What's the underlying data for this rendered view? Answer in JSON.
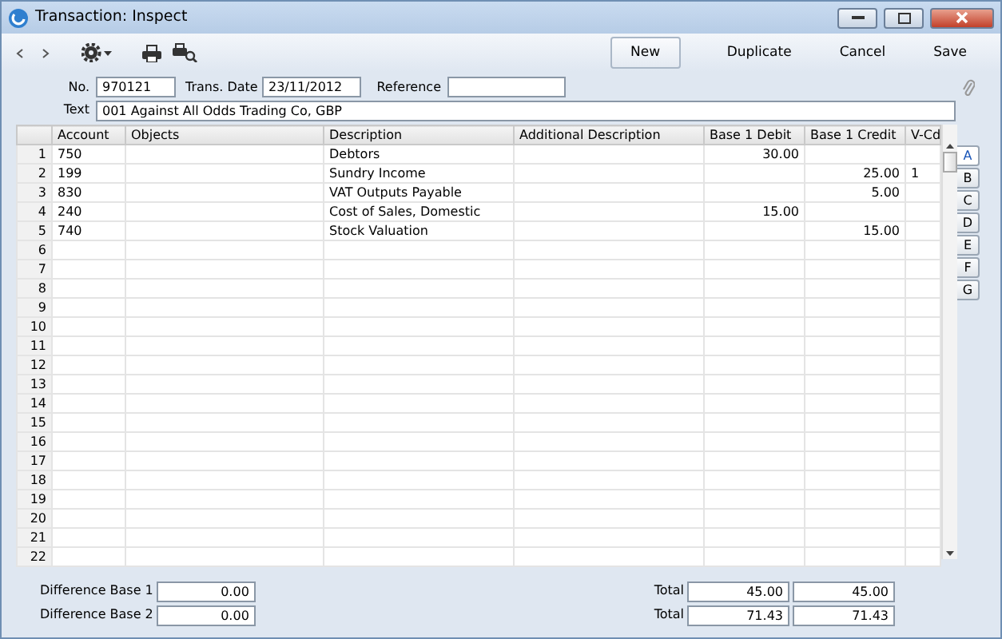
{
  "window": {
    "title": "Transaction: Inspect"
  },
  "toolbar": {
    "buttons": [
      {
        "label": "New",
        "default": true
      },
      {
        "label": "Duplicate",
        "default": false
      },
      {
        "label": "Cancel",
        "default": false
      },
      {
        "label": "Save",
        "default": false
      }
    ]
  },
  "header": {
    "fields": [
      {
        "label": "No.",
        "value": "970121"
      },
      {
        "label": "Trans. Date",
        "value": "23/11/2012"
      },
      {
        "label": "Reference"
      }
    ],
    "text": {
      "label": "Text",
      "value": "001 Against All Odds Trading Co, GBP"
    }
  },
  "table": {
    "columns": [
      "Account",
      "Objects",
      "Description",
      "Additional Description",
      "Base 1 Debit",
      "Base 1 Credit",
      "V-Cd"
    ],
    "rows": [
      {
        "number": "1",
        "account": "750",
        "description": "Debtors",
        "base_1_debit": "30.00"
      },
      {
        "number": "2",
        "account": "199",
        "description": "Sundry Income",
        "base_1_credit": "25.00",
        "v_cd": "1"
      },
      {
        "number": "3",
        "account": "830",
        "description": "VAT Outputs Payable",
        "base_1_credit": "5.00"
      },
      {
        "number": "4",
        "account": "240",
        "description": "Cost of Sales, Domestic",
        "base_1_debit": "15.00"
      },
      {
        "number": "5",
        "account": "740",
        "description": "Stock Valuation",
        "base_1_credit": "15.00"
      },
      {
        "number": "6"
      },
      {
        "number": "7"
      },
      {
        "number": "8"
      },
      {
        "number": "9"
      },
      {
        "number": "10"
      },
      {
        "number": "11"
      },
      {
        "number": "12"
      },
      {
        "number": "13"
      },
      {
        "number": "14"
      },
      {
        "number": "15"
      },
      {
        "number": "16"
      },
      {
        "number": "17"
      },
      {
        "number": "18"
      },
      {
        "number": "19"
      },
      {
        "number": "20"
      },
      {
        "number": "21"
      },
      {
        "number": "22"
      }
    ]
  },
  "side_tabs": [
    {
      "label": "A",
      "selected": true
    },
    {
      "label": "B",
      "selected": false
    },
    {
      "label": "C",
      "selected": false
    },
    {
      "label": "D",
      "selected": false
    },
    {
      "label": "E",
      "selected": false
    },
    {
      "label": "F",
      "selected": false
    },
    {
      "label": "G",
      "selected": false
    }
  ],
  "footer": {
    "differences": [
      {
        "label": "Difference Base 1",
        "value": "0.00"
      },
      {
        "label": "Difference Base 2",
        "value": "0.00"
      }
    ],
    "totals": [
      {
        "label": "Total",
        "debit": "45.00",
        "credit": "45.00"
      },
      {
        "label": "Total",
        "debit": "71.43",
        "credit": "71.43"
      }
    ]
  }
}
